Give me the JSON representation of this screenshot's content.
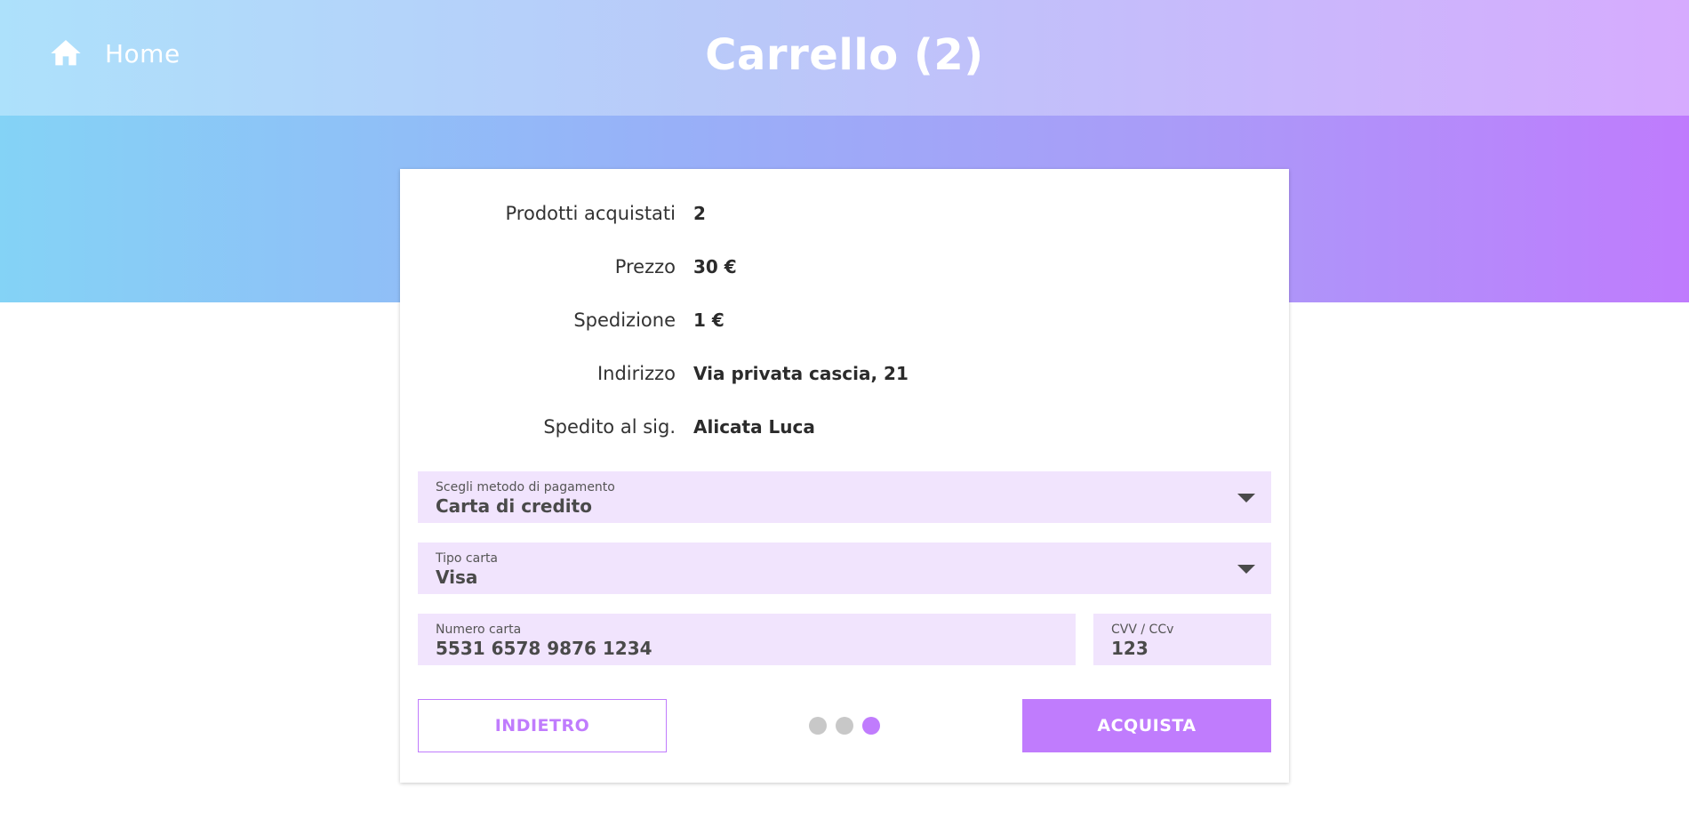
{
  "header": {
    "home_label": "Home",
    "title": "Carrello (2)"
  },
  "summary": {
    "rows": [
      {
        "label": "Prodotti acquistati",
        "value": "2"
      },
      {
        "label": "Prezzo",
        "value": "30 €"
      },
      {
        "label": "Spedizione",
        "value": "1 €"
      },
      {
        "label": "Indirizzo",
        "value": "Via privata cascia, 21"
      },
      {
        "label": "Spedito al sig.",
        "value": "Alicata Luca"
      }
    ]
  },
  "form": {
    "payment_method": {
      "label": "Scegli metodo di pagamento",
      "value": "Carta di credito"
    },
    "card_type": {
      "label": "Tipo carta",
      "value": "Visa"
    },
    "card_number": {
      "label": "Numero carta",
      "value": "5531 6578 9876 1234"
    },
    "cvv": {
      "label": "CVV / CCv",
      "value": "123"
    }
  },
  "actions": {
    "back_label": "INDIETRO",
    "buy_label": "ACQUISTA"
  },
  "steps": {
    "total": 3,
    "current": 3
  },
  "colors": {
    "accent": "#c07cfd",
    "field_bg": "#f1e4fd",
    "dot_inactive": "#c8c8c8"
  },
  "icons": {
    "home": "home-icon",
    "dropdown": "caret-down-icon"
  }
}
